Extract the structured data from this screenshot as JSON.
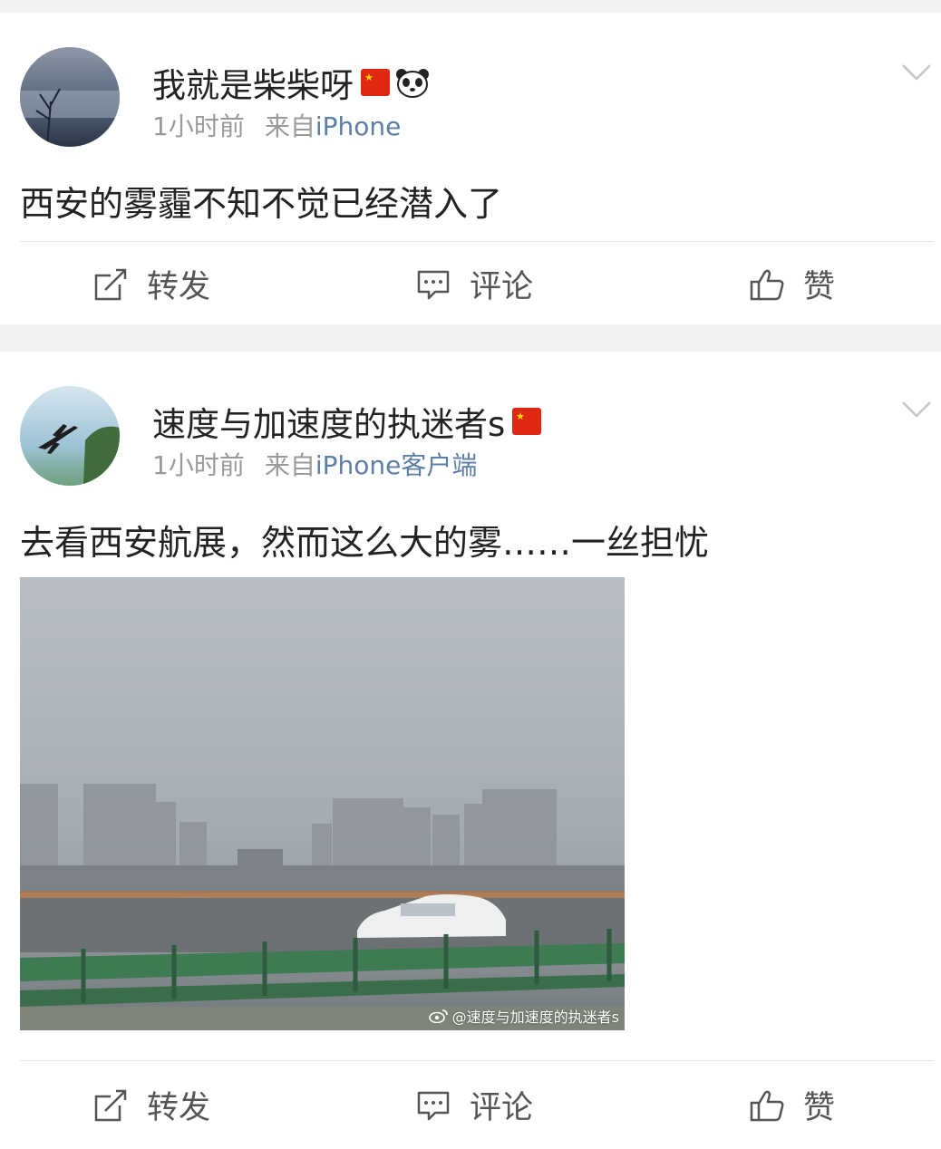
{
  "posts": [
    {
      "username": "我就是柴柴呀",
      "badges": [
        "china-flag",
        "panda-emoji"
      ],
      "time": "1小时前",
      "source_label": "来自",
      "source_device": "iPhone",
      "text": "西安的雾霾不知不觉已经潜入了",
      "actions": {
        "repost": "转发",
        "comment": "评论",
        "like": "赞"
      }
    },
    {
      "username": "速度与加速度的执迷者s",
      "badges": [
        "china-flag"
      ],
      "time": "1小时前",
      "source_label": "来自",
      "source_device": "iPhone客户端",
      "text": "去看西安航展，然而这么大的雾……一丝担忧",
      "image_watermark": "@速度与加速度的执迷者s",
      "actions": {
        "repost": "转发",
        "comment": "评论",
        "like": "赞"
      }
    }
  ],
  "colors": {
    "background": "#f2f2f2",
    "card": "#ffffff",
    "meta_text": "#9a9a9a",
    "link_text": "#5d7fa5"
  }
}
